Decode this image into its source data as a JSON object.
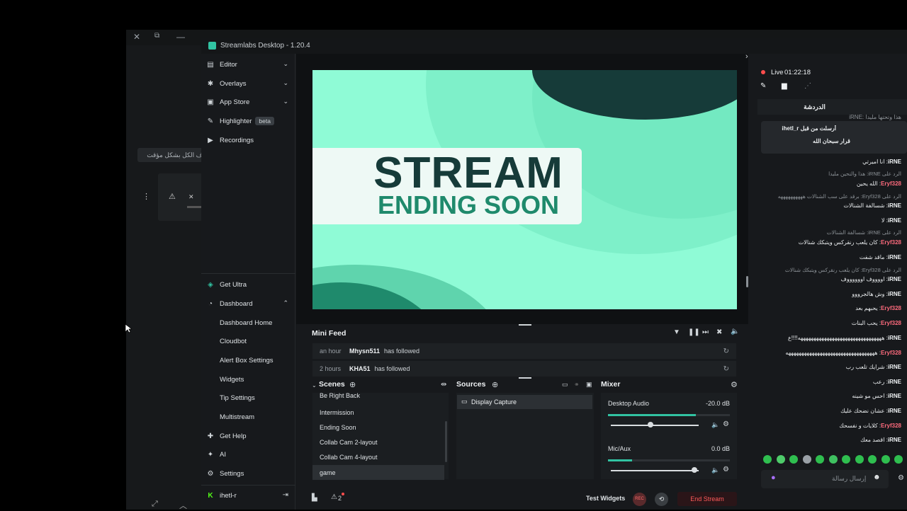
{
  "background_window": {
    "controls": [
      "✕",
      "⧉",
      "—"
    ],
    "button_text": "ف الكل بشكل مؤقت",
    "icons": [
      "more-vertical-icon",
      "warning-icon",
      "action-icon"
    ],
    "bottom_icons": [
      "external-link-icon",
      "chevron-up-icon"
    ]
  },
  "app": {
    "title": "Streamlabs Desktop - 1.20.4"
  },
  "nav": {
    "top": [
      {
        "label": "Editor",
        "icon": "editor-icon",
        "chevron": true
      },
      {
        "label": "Overlays",
        "icon": "overlays-icon",
        "chevron": true
      },
      {
        "label": "App Store",
        "icon": "app-store-icon",
        "chevron": true
      },
      {
        "label": "Highlighter",
        "icon": "highlighter-icon",
        "badge": "beta"
      },
      {
        "label": "Recordings",
        "icon": "recordings-icon"
      }
    ],
    "bottom": [
      {
        "label": "Get Ultra",
        "icon": "ultra-icon"
      },
      {
        "label": "Dashboard",
        "icon": "dashboard-icon",
        "chevron": true
      },
      {
        "label": "Dashboard Home",
        "sub": true
      },
      {
        "label": "Cloudbot",
        "sub": true
      },
      {
        "label": "Alert Box Settings",
        "sub": true
      },
      {
        "label": "Widgets",
        "sub": true
      },
      {
        "label": "Tip Settings",
        "sub": true
      },
      {
        "label": "Multistream",
        "sub": true
      },
      {
        "label": "Get Help",
        "icon": "help-icon"
      },
      {
        "label": "AI",
        "icon": "ai-icon"
      },
      {
        "label": "Settings",
        "icon": "settings-icon"
      }
    ],
    "user": "ihetl-r"
  },
  "preview": {
    "line1": "STREAM",
    "line2": "ENDING SOON"
  },
  "mini_feed": {
    "title": "Mini Feed",
    "items": [
      {
        "time": "an hour",
        "name": "Mhysn511",
        "action": "has followed"
      },
      {
        "time": "2 hours",
        "name": "KHA51",
        "action": "has followed"
      }
    ]
  },
  "scenes": {
    "title": "Scenes",
    "items": [
      "Be Right Back",
      "Intermission",
      "Ending Soon",
      "Collab Cam 2-layout",
      "Collab Cam 4-layout",
      "game"
    ],
    "selected": "game"
  },
  "sources": {
    "title": "Sources",
    "items": [
      "Display Capture"
    ]
  },
  "mixer": {
    "title": "Mixer",
    "channels": [
      {
        "name": "Desktop Audio",
        "db": "-20.0 dB",
        "level": 0.72,
        "volume": 0.45
      },
      {
        "name": "Mic/Aux",
        "db": "0.0 dB",
        "level": 0.2,
        "volume": 0.95
      }
    ]
  },
  "footer": {
    "alerts_count": "2",
    "test_widgets": "Test Widgets",
    "rec": "REC",
    "end_stream": "End Stream"
  },
  "live": {
    "label": "Live",
    "time": "01:22:18"
  },
  "chat": {
    "title": "الدردشة",
    "pinned_header": "ihetl_r أرسلت من قبل",
    "pinned_message": "قرار سبحان الله",
    "top_partial": "هذا وتحتها مليدا :iRNE",
    "lines": [
      {
        "type": "msg",
        "user": "iRNE",
        "color": "u1",
        "text": "انا اميرتي"
      },
      {
        "type": "reply",
        "text": "الرد على iRNE: هذا والتحين مليدا"
      },
      {
        "type": "msg",
        "user": "Eryf328",
        "color": "u2",
        "text": "الله يحين"
      },
      {
        "type": "reply",
        "text": "الرد على Eryf328: برقد على سب الشنالات ههههههههههه"
      },
      {
        "type": "msg",
        "user": "iRNE",
        "color": "u1",
        "text": "شسالفة الشنالات"
      },
      {
        "type": "msg",
        "user": "iRNE",
        "color": "u1",
        "text": "لا"
      },
      {
        "type": "reply",
        "text": "الرد على iRNE: شسالفة الشنالات"
      },
      {
        "type": "msg",
        "user": "Eryf328",
        "color": "u2",
        "text": "كان يلعب رنقركس ويتبكك شنالات"
      },
      {
        "type": "msg",
        "user": "iRNE",
        "color": "u1",
        "text": "ماقد شفت"
      },
      {
        "type": "reply",
        "text": "الرد على Eryf328: كان يلعب رنقركس ويتبكك شنالات"
      },
      {
        "type": "msg",
        "user": "iRNE",
        "color": "u1",
        "text": "اووووف اووووووف"
      },
      {
        "type": "msg",
        "user": "iRNE",
        "color": "u1",
        "text": "وش هالجرووو"
      },
      {
        "type": "msg",
        "user": "Eryf328",
        "color": "u2",
        "text": "يحبهم بعد"
      },
      {
        "type": "msg",
        "user": "Eryf328",
        "color": "u2",
        "text": "يحب البنات"
      },
      {
        "type": "msg",
        "user": "iRNE",
        "color": "u1",
        "text": "ههههههههههههههههههههههههههههههههه!!!!ع"
      },
      {
        "type": "msg",
        "user": "Eryf328",
        "color": "u2",
        "text": "ههههههههههههههههههههههههههههههههههه"
      },
      {
        "type": "msg",
        "user": "iRNE",
        "color": "u1",
        "text": "شرايك تلعب رب"
      },
      {
        "type": "msg",
        "user": "iRNE",
        "color": "u1",
        "text": "رعب"
      },
      {
        "type": "msg",
        "user": "iRNE",
        "color": "u1",
        "text": "احس مو شينه"
      },
      {
        "type": "msg",
        "user": "iRNE",
        "color": "u1",
        "text": "عشان نضحك عليك"
      },
      {
        "type": "msg",
        "user": "Eryf328",
        "color": "u2",
        "text": "كلايات و نفسحك"
      },
      {
        "type": "msg",
        "user": "iRNE",
        "color": "u1",
        "text": "اقصد معك"
      }
    ],
    "input_placeholder": "إرسال رسالة"
  },
  "colors": {
    "accent": "#31c3a2",
    "live": "#ff4d4d",
    "preview_bg": "#8ffbd6",
    "preview_dark": "#163b39"
  }
}
